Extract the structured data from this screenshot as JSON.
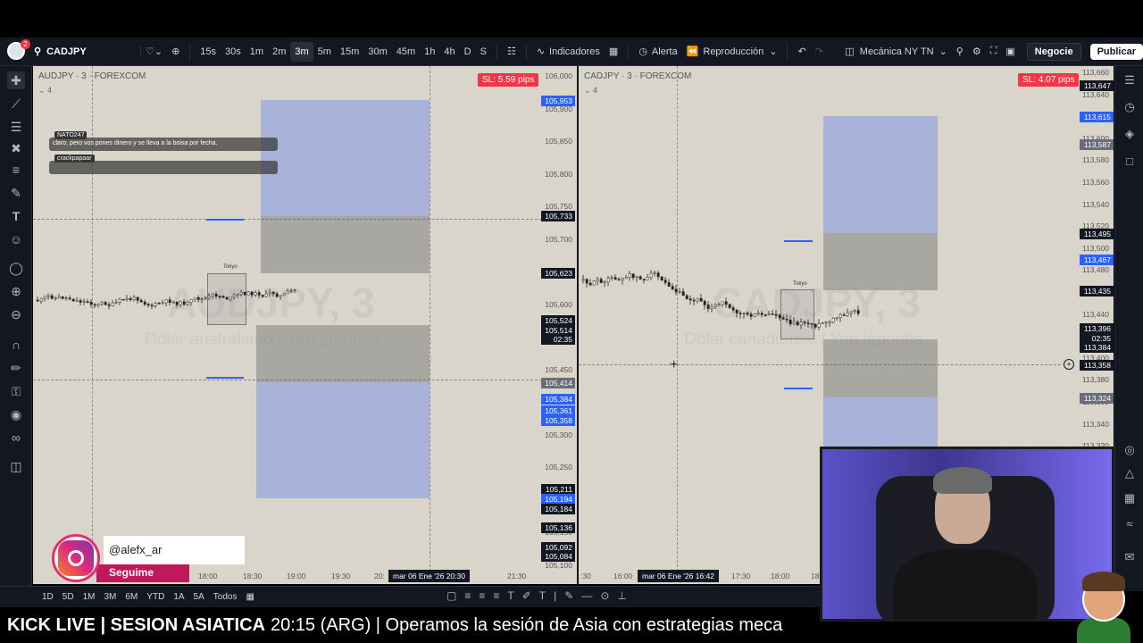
{
  "toolbar": {
    "notification_count": "2",
    "symbol": "CADJPY",
    "intervals": [
      "15s",
      "30s",
      "1m",
      "2m",
      "3m",
      "5m",
      "15m",
      "30m",
      "45m",
      "1h",
      "4h",
      "D",
      "S"
    ],
    "active_interval": "3m",
    "indicators_label": "Indicadores",
    "alert_label": "Alerta",
    "replay_label": "Reproducción",
    "layout_name": "Mecánica NY TN",
    "trade_label": "Negocie",
    "publish_label": "Publicar"
  },
  "left_chart": {
    "title": "AUDJPY · 3 · FOREXCOM",
    "sub": "4",
    "watermark": "AUDJPY, 3",
    "watermark_sub": "Dólar australiano / Yen japonés",
    "sl_badge": "SL: 5.59 pips",
    "axis_labels": [
      "106,000",
      "105,900",
      "105,850",
      "105,800",
      "105,750",
      "105,700",
      "105,650",
      "105,600",
      "105,550",
      "105,450",
      "105,400",
      "105,300",
      "105,250",
      "105,200",
      "105,150",
      "105,100"
    ],
    "price_tags": [
      {
        "text": "105,953",
        "kind": "blue"
      },
      {
        "text": "105,733",
        "kind": "dark"
      },
      {
        "text": "105,623",
        "kind": "dark"
      },
      {
        "text": "105,524",
        "kind": "dark"
      },
      {
        "text": "105,514",
        "kind": "dark"
      },
      {
        "text": "02:35",
        "kind": "dark"
      },
      {
        "text": "105,414",
        "kind": "gray"
      },
      {
        "text": "105,384",
        "kind": "blue"
      },
      {
        "text": "105,361",
        "kind": "blue"
      },
      {
        "text": "105,358",
        "kind": "blue"
      },
      {
        "text": "105,211",
        "kind": "dark"
      },
      {
        "text": "105,194",
        "kind": "blue"
      },
      {
        "text": "105,184",
        "kind": "dark"
      },
      {
        "text": "105,136",
        "kind": "dark"
      },
      {
        "text": "105,092",
        "kind": "dark"
      },
      {
        "text": "105,084",
        "kind": "dark"
      }
    ],
    "time_labels": [
      "18:00",
      "18:30",
      "19:00",
      "19:30",
      "20:",
      "21:30"
    ],
    "time_badge": "mar 06 Ene '26   20:30",
    "session_label": "Tokyo",
    "chat": [
      {
        "user": "NATO247",
        "message": "claro, pero vos pones dinero y se lleva a la boisa por fecha."
      },
      {
        "user": "crackpapaar",
        "message": ""
      }
    ]
  },
  "right_chart": {
    "title": "CADJPY · 3 · FOREXCOM",
    "sub": "4",
    "watermark": "CADJPY, 3",
    "watermark_sub": "Dólar canadiense / Yen japonés",
    "sl_badge": "SL: 4.07 pips",
    "axis_labels": [
      "113,660",
      "113,640",
      "113,620",
      "113,600",
      "113,580",
      "113,560",
      "113,540",
      "113,520",
      "113,500",
      "113,480",
      "113,460",
      "113,440",
      "113,420",
      "113,400",
      "113,380",
      "113,360",
      "113,340",
      "113,320",
      "113,300",
      "113,280"
    ],
    "price_tags": [
      {
        "text": "113,647",
        "kind": "dark"
      },
      {
        "text": "113,615",
        "kind": "blue"
      },
      {
        "text": "113,587",
        "kind": "gray"
      },
      {
        "text": "113,495",
        "kind": "dark"
      },
      {
        "text": "113,467",
        "kind": "blue"
      },
      {
        "text": "113,435",
        "kind": "dark"
      },
      {
        "text": "113,396",
        "kind": "dark"
      },
      {
        "text": "02:35",
        "kind": "dark"
      },
      {
        "text": "113,384",
        "kind": "dark"
      },
      {
        "text": "113,358",
        "kind": "dark"
      },
      {
        "text": "113,324",
        "kind": "gray"
      }
    ],
    "time_labels": [
      ":30",
      "16:00",
      "17:30",
      "18:00",
      "18"
    ],
    "time_badge": "mar 06 Ene '26   16:42",
    "session_label": "Tokyo"
  },
  "bottom": {
    "ranges": [
      "1D",
      "5D",
      "1M",
      "3M",
      "6M",
      "YTD",
      "1A",
      "5A",
      "Todos"
    ]
  },
  "ticker": {
    "title": "KICK LIVE | SESION ASIATICA",
    "text": "20:15 (ARG) | Operamos la sesión de Asia con estrategias meca"
  },
  "instagram": {
    "handle": "@alefx_ar",
    "follow": "Seguime"
  },
  "colors": {
    "target_zone": "#95a5de",
    "entry_zone": "#828282",
    "chart_bg": "#d9d5cb",
    "sl_badge": "#f23645",
    "tag_blue": "#2962ff"
  }
}
